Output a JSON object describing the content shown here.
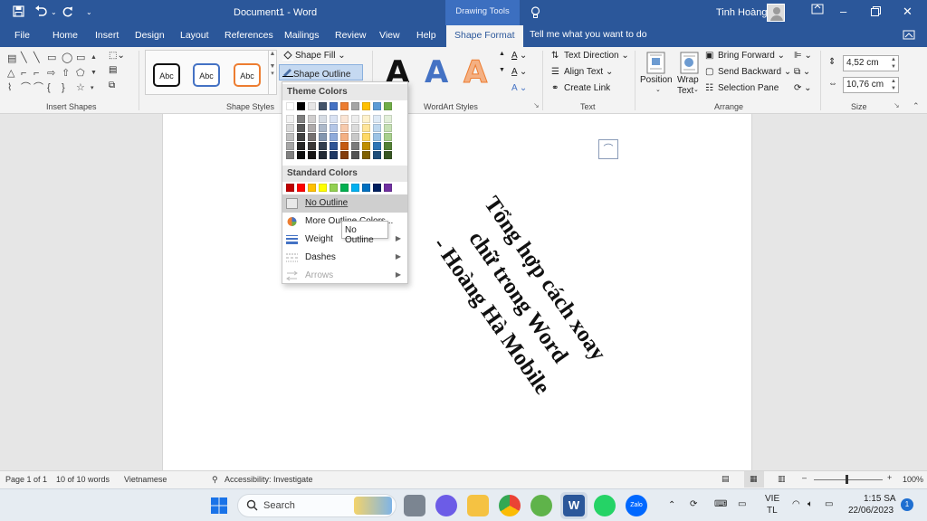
{
  "title_bar": {
    "doc_title": "Document1  -  Word",
    "context_tab": "Drawing Tools",
    "user_name": "Tinh Hoàng",
    "save_icon": "save-icon",
    "undo_icon": "undo-icon",
    "redo_icon": "redo-icon"
  },
  "tabs": [
    {
      "label": "File"
    },
    {
      "label": "Home"
    },
    {
      "label": "Insert"
    },
    {
      "label": "Design"
    },
    {
      "label": "Layout"
    },
    {
      "label": "References"
    },
    {
      "label": "Mailings"
    },
    {
      "label": "Review"
    },
    {
      "label": "View"
    },
    {
      "label": "Help"
    },
    {
      "label": "Shape Format",
      "active": true
    }
  ],
  "tell_me": "Tell me what you want to do",
  "ribbon": {
    "groups": {
      "insert_shapes": "Insert Shapes",
      "shape_styles": "Shape Styles",
      "wordart_styles": "WordArt Styles",
      "text": "Text",
      "arrange": "Arrange",
      "size": "Size"
    },
    "style_samples": [
      "Abc",
      "Abc",
      "Abc"
    ],
    "shape_fill": "Shape Fill",
    "shape_outline": "Shape Outline",
    "text_direction": "Text Direction",
    "align_text": "Align Text",
    "create_link": "Create Link",
    "position": "Position",
    "wrap_text_1": "Wrap",
    "wrap_text_2": "Text",
    "bring_forward": "Bring Forward",
    "send_backward": "Send Backward",
    "selection_pane": "Selection Pane",
    "height": "4,52 cm",
    "width": "10,76 cm"
  },
  "dropdown": {
    "theme_header": "Theme Colors",
    "standard_header": "Standard Colors",
    "no_outline": "No Outline",
    "more_colors": "More Outline Colors...",
    "weight": "Weight",
    "dashes": "Dashes",
    "arrows": "Arrows",
    "tooltip": "No Outline",
    "theme_top": [
      "#FFFFFF",
      "#000000",
      "#E7E6E6",
      "#44546A",
      "#4472C4",
      "#ED7D31",
      "#A5A5A5",
      "#FFC000",
      "#5B9BD5",
      "#70AD47"
    ],
    "theme_shades": [
      [
        "#F2F2F2",
        "#D9D9D9",
        "#BFBFBF",
        "#A6A6A6",
        "#808080"
      ],
      [
        "#808080",
        "#595959",
        "#404040",
        "#262626",
        "#0D0D0D"
      ],
      [
        "#D0CECE",
        "#AEAAAA",
        "#767171",
        "#3A3838",
        "#171616"
      ],
      [
        "#D6DCE4",
        "#ADB9CA",
        "#8497B0",
        "#333F4F",
        "#222A35"
      ],
      [
        "#D9E2F3",
        "#B4C6E7",
        "#8EAADB",
        "#2F5496",
        "#1F3864"
      ],
      [
        "#FBE5D5",
        "#F7CAAC",
        "#F4B083",
        "#C55A11",
        "#833C0B"
      ],
      [
        "#EDEDED",
        "#DBDBDB",
        "#C9C9C9",
        "#7B7B7B",
        "#525252"
      ],
      [
        "#FFF2CC",
        "#FFE599",
        "#FFD966",
        "#BF8F00",
        "#7F6000"
      ],
      [
        "#DEEAF6",
        "#BDD7EE",
        "#9CC3E5",
        "#2E75B5",
        "#1E4E79"
      ],
      [
        "#E2EFD9",
        "#C5E0B3",
        "#A8D08D",
        "#538135",
        "#375623"
      ]
    ],
    "standard": [
      "#C00000",
      "#FF0000",
      "#FFC000",
      "#FFFF00",
      "#92D050",
      "#00B050",
      "#00B0F0",
      "#0070C0",
      "#002060",
      "#7030A0"
    ]
  },
  "document": {
    "rotated_lines": [
      "Tổng hợp cách xoay",
      "chữ trong Word",
      "- Hoàng Hà Mobile"
    ]
  },
  "status": {
    "page": "Page 1 of 1",
    "words": "10 of 10 words",
    "language": "Vietnamese",
    "accessibility": "Accessibility: Investigate",
    "zoom": "100%"
  },
  "taskbar": {
    "search": "Search",
    "lang1": "VIE",
    "lang2": "TL",
    "time": "1:15 SA",
    "date": "22/06/2023",
    "badge": "1"
  }
}
